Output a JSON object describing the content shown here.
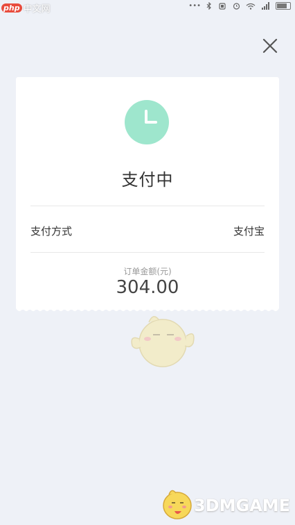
{
  "watermark_top": {
    "brand": "php",
    "site": "中文网"
  },
  "status_bar": {
    "dots": "•••"
  },
  "card": {
    "title": "支付中",
    "payment_method_label": "支付方式",
    "payment_method_value": "支付宝",
    "amount_label": "订单金额(元)",
    "amount": "304.00"
  },
  "watermark_bottom": {
    "text": "3DMGAME"
  },
  "colors": {
    "background": "#eef1f7",
    "clock": "#9ee6cd",
    "card": "#ffffff"
  },
  "icons": [
    "close-icon",
    "clock-icon",
    "bluetooth-icon",
    "wifi-icon",
    "signal-icon",
    "battery-icon",
    "alarm-icon"
  ]
}
